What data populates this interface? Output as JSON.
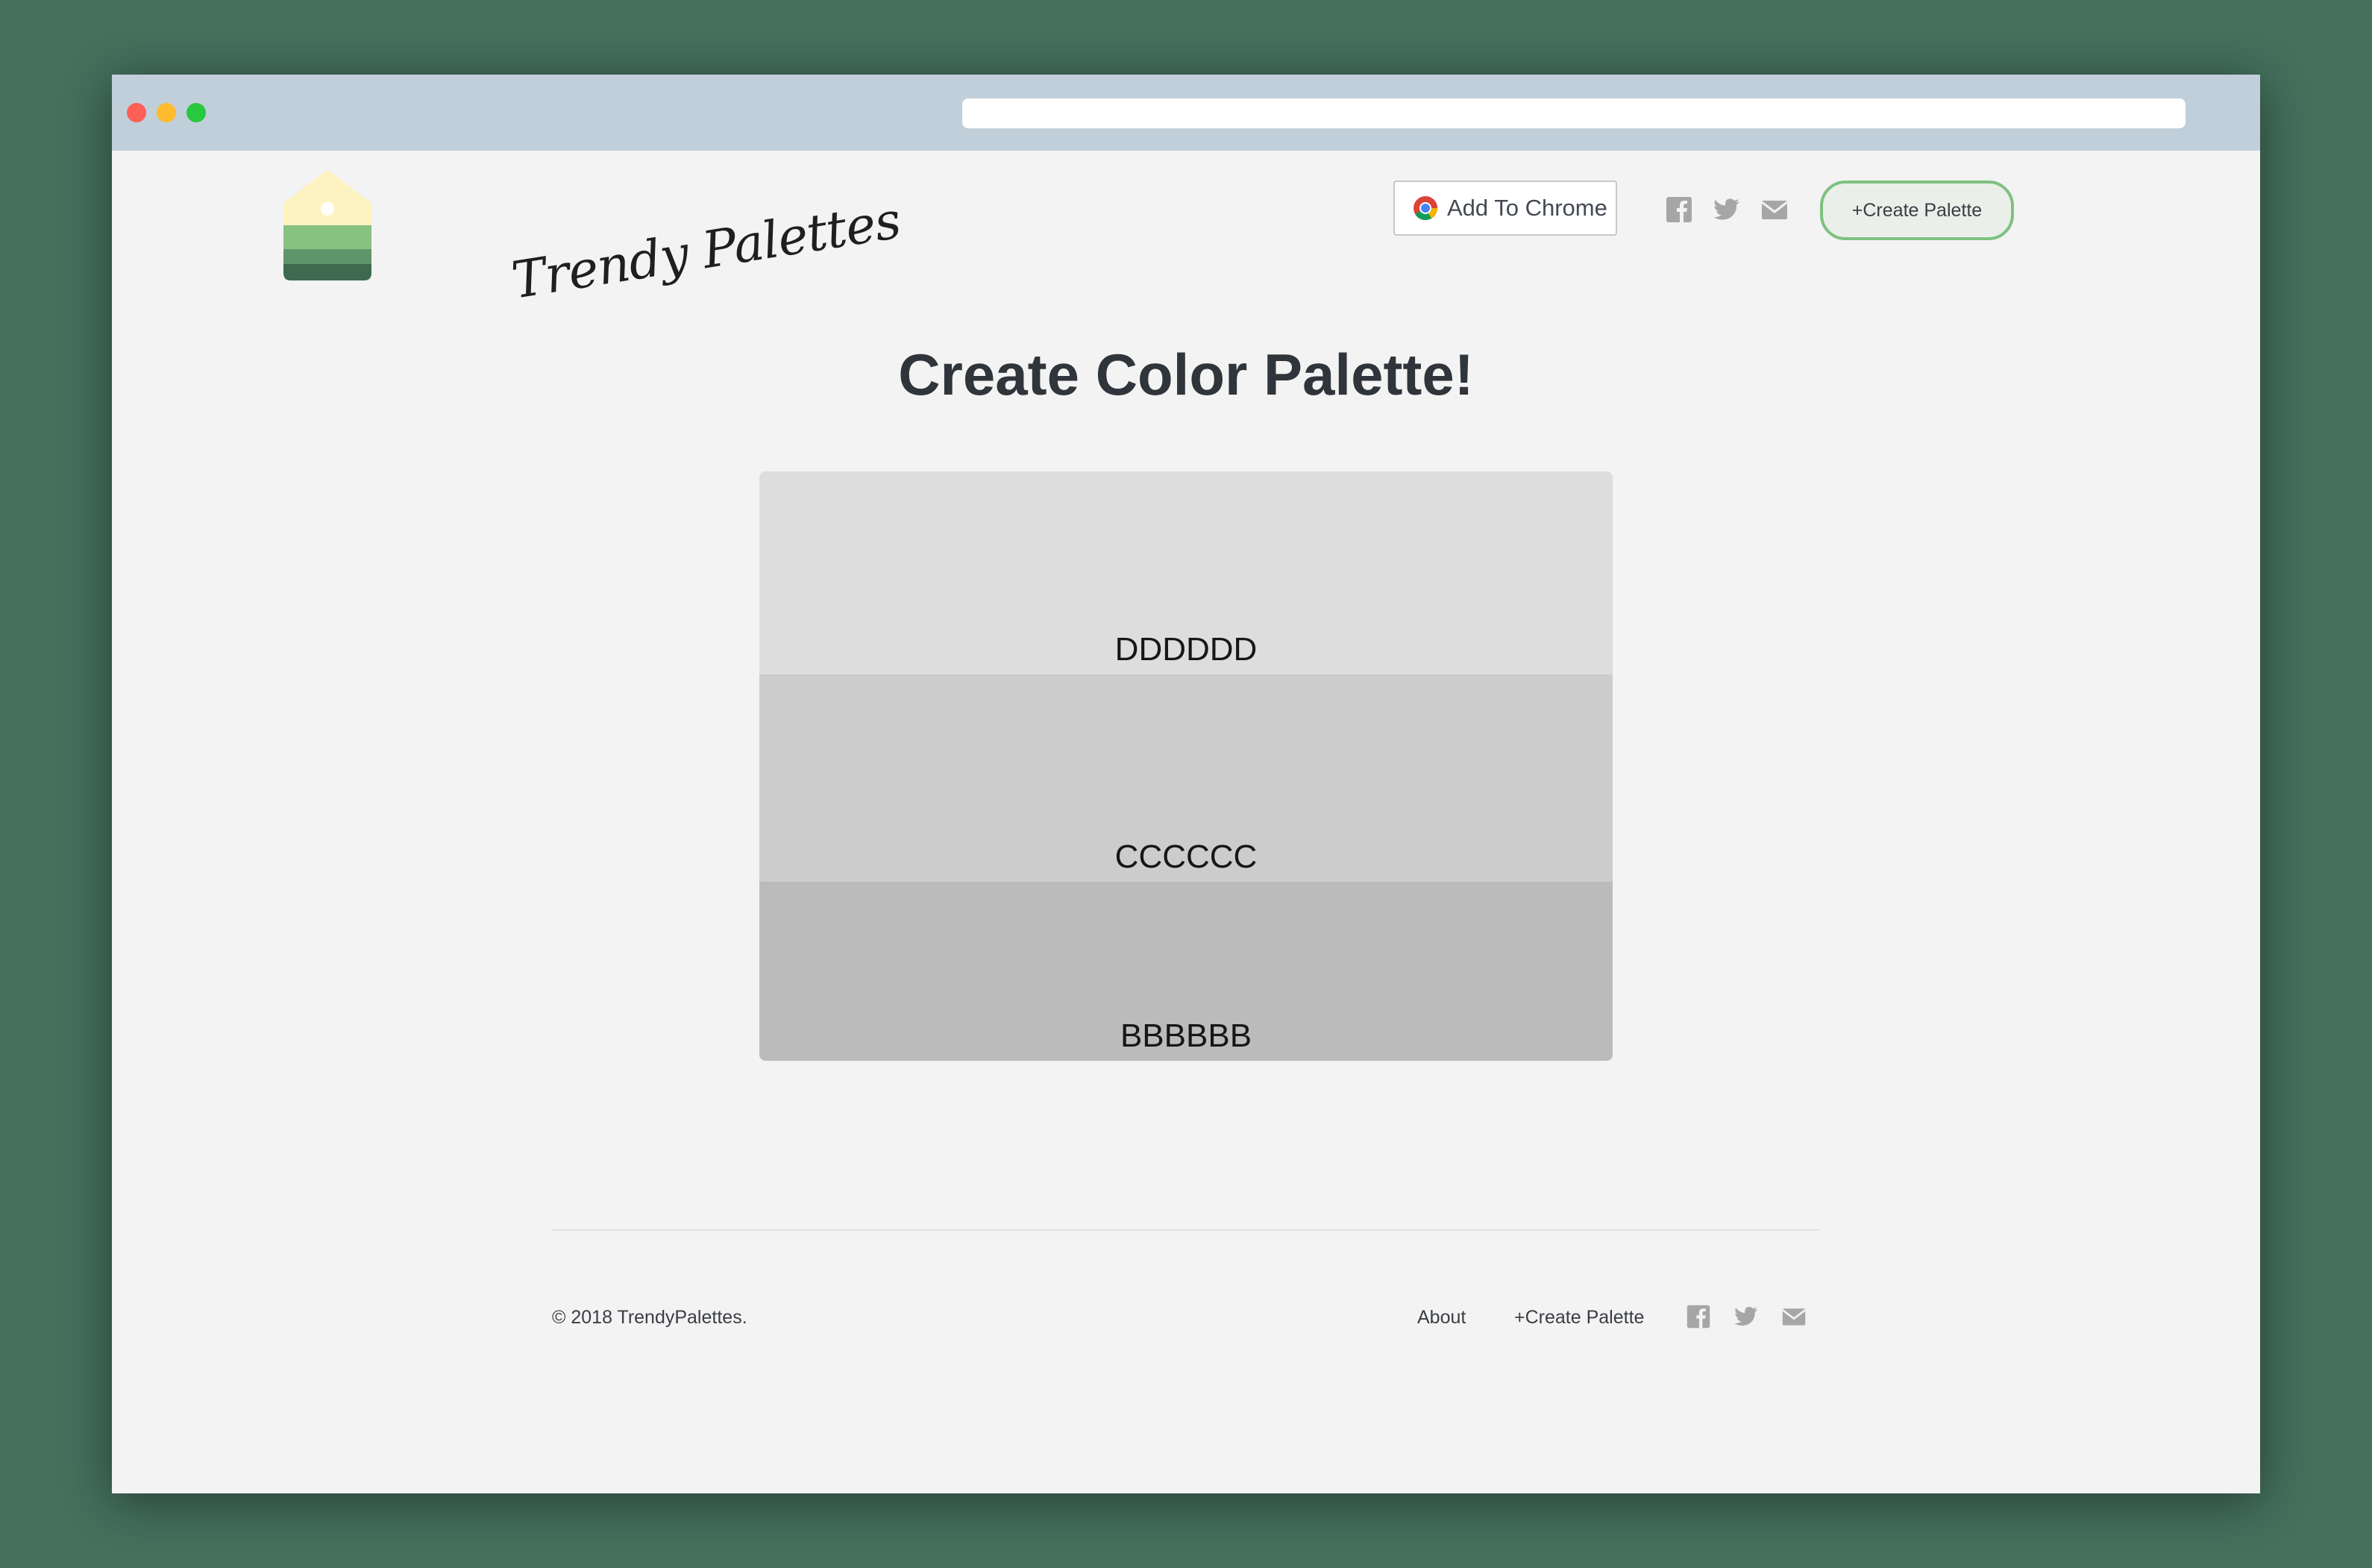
{
  "window": {
    "traffic_lights": [
      "#fe5f57",
      "#febc2e",
      "#28c840"
    ]
  },
  "header": {
    "brand": "Trendy Palettes",
    "add_chrome_label": "Add To Chrome",
    "create_palette_label": "+Create Palette",
    "social_icons": [
      "facebook-icon",
      "twitter-icon",
      "mail-icon"
    ]
  },
  "main": {
    "title": "Create Color Palette!",
    "swatches": [
      {
        "label": "DDDDDD",
        "color": "#dddddd"
      },
      {
        "label": "CCCCCC",
        "color": "#cccccc"
      },
      {
        "label": "BBBBBB",
        "color": "#bbbbbb"
      }
    ]
  },
  "footer": {
    "copyright": "© 2018 TrendyPalettes.",
    "links": [
      "About",
      "+Create Palette"
    ],
    "social_icons": [
      "facebook-icon",
      "twitter-icon",
      "mail-icon"
    ]
  },
  "colors": {
    "background": "#44705c",
    "titlebar": "#c1cfda",
    "page": "#f3f3f3",
    "accent_green": "#7ec17f",
    "icon_gray": "#a6a6a6"
  }
}
